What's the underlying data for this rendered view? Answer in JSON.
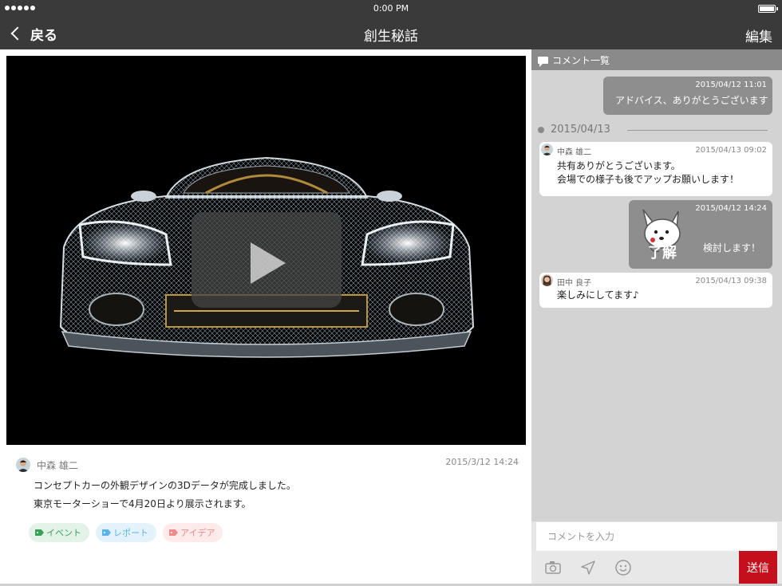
{
  "status_bar": {
    "time": "0:00 PM"
  },
  "nav": {
    "back_label": "戻る",
    "title": "創生秘話",
    "edit_label": "編集"
  },
  "post": {
    "author": "中森 雄二",
    "timestamp": "2015/3/12 14:24",
    "body_lines": [
      "コンセプトカーの外観デザインの3Dデータが完成しました。",
      "東京モーターショーで4月20日より展示されます。"
    ],
    "tags": [
      {
        "label": "イベント",
        "color": "#3aa05a",
        "bg": "#e3f3e7"
      },
      {
        "label": "レポート",
        "color": "#5ab4e6",
        "bg": "#e4f3fb"
      },
      {
        "label": "アイデア",
        "color": "#f08a8a",
        "bg": "#fdeaea"
      }
    ]
  },
  "comments": {
    "header": "コメント一覧",
    "items": [
      {
        "own": true,
        "time": "2015/04/12 11:01",
        "text": "アドバイス、ありがとうございます"
      },
      {
        "date_separator": "2015/04/13"
      },
      {
        "own": false,
        "author": "中森 雄二",
        "time": "2015/04/13 09:02",
        "lines": [
          "共有ありがとうございます。",
          "会場での様子も後でアップお願いします！"
        ]
      },
      {
        "own": true,
        "sticker": true,
        "sticker_text": "了解",
        "time": "2015/04/12 14:24",
        "text": "検討します！"
      },
      {
        "own": false,
        "author": "田中 良子",
        "time": "2015/04/13 09:38",
        "lines": [
          "楽しみにしてます♪"
        ]
      }
    ],
    "input_placeholder": "コメントを入力",
    "send_label": "送信"
  },
  "colors": {
    "bar": "#3a3a3a",
    "accent": "#c4101c",
    "own_bubble": "#8e8e8e",
    "panel": "#d3d3d3"
  },
  "icons": [
    "back-chevron-icon",
    "play-icon",
    "tag-icon",
    "comment-icon",
    "camera-icon",
    "location-icon",
    "smiley-icon"
  ]
}
